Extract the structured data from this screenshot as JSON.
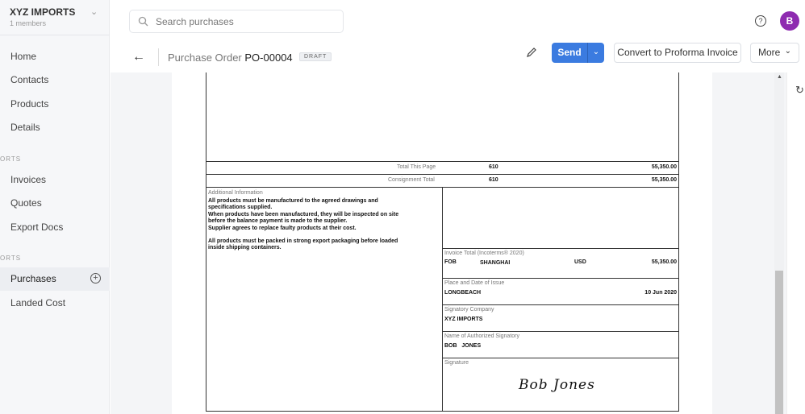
{
  "org": {
    "name": "XYZ IMPORTS",
    "members": "1 members"
  },
  "sidebar": {
    "items": [
      {
        "label": "Home"
      },
      {
        "label": "Contacts"
      },
      {
        "label": "Products"
      },
      {
        "label": "Details"
      }
    ],
    "section_exports": "ORTS",
    "exports": [
      {
        "label": "Invoices"
      },
      {
        "label": "Quotes"
      },
      {
        "label": "Export Docs"
      }
    ],
    "section_imports": "ORTS",
    "imports": [
      {
        "label": "Purchases",
        "active": true
      },
      {
        "label": "Landed Cost"
      }
    ]
  },
  "search": {
    "placeholder": "Search purchases"
  },
  "header": {
    "title_prefix": "Purchase Order",
    "doc_number": "PO-00004",
    "status": "DRAFT",
    "send": "Send",
    "convert": "Convert to Proforma Invoice",
    "more": "More",
    "avatar": "B",
    "avatar_color": "#8e2bb0",
    "accent": "#3b7be0"
  },
  "document": {
    "total_page_label": "Total This Page",
    "total_page_qty": "610",
    "total_page_amount": "55,350.00",
    "consignment_label": "Consignment Total",
    "consignment_qty": "610",
    "consignment_amount": "55,350.00",
    "additional_label": "Additional Information",
    "additional_lines": [
      "All products must be manufactured to the agreed drawings and",
      "specifications supplied.",
      "When products have been manufactured, they will be inspected on site",
      "before the balance payment is made to the supplier.",
      "Supplier agrees to replace faulty products at their cost.",
      "All products must be packed in strong export packaging before loaded",
      "inside shipping containers."
    ],
    "invoice_total_label": "Invoice Total (Incoterms® 2020)",
    "incoterm": "FOB",
    "port": "SHANGHAI",
    "currency": "USD",
    "invoice_total": "55,350.00",
    "place_label": "Place and Date of Issue",
    "place": "LONGBEACH",
    "date": "10 Jun 2020",
    "company_label": "Signatory Company",
    "company": "XYZ IMPORTS",
    "signatory_label": "Name of Authorized Signatory",
    "signatory": "BOB   JONES",
    "signature_label": "Signature",
    "signature": "Bob Jones"
  }
}
